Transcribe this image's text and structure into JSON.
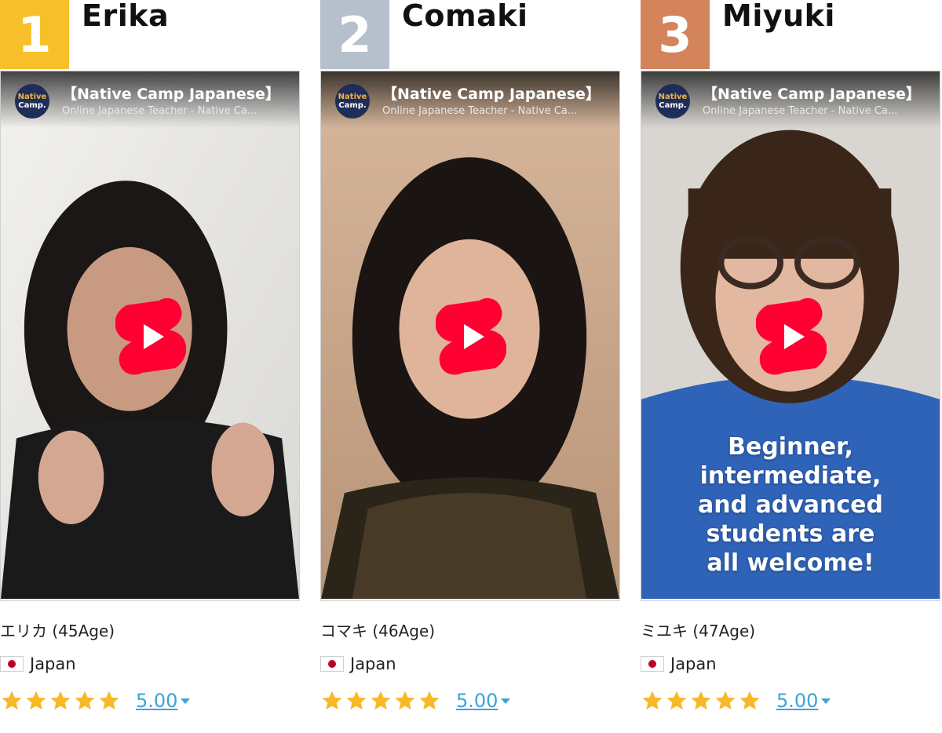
{
  "teachers": [
    {
      "rank": "1",
      "name": "Erika",
      "badge_color": "#f7c02a",
      "video": {
        "title": "【Native Camp Japanese】",
        "subtitle": "Online Japanese Teacher - Native Ca...",
        "logo_line1": "Native",
        "logo_line2": "Camp.",
        "caption": ""
      },
      "age_text": "エリカ (45Age)",
      "country": "Japan",
      "stars": 5,
      "rating": "5.00"
    },
    {
      "rank": "2",
      "name": "Comaki",
      "badge_color": "#b5c0cc",
      "video": {
        "title": "【Native Camp Japanese】",
        "subtitle": "Online Japanese Teacher - Native Ca...",
        "logo_line1": "Native",
        "logo_line2": "Camp.",
        "caption": ""
      },
      "age_text": "コマキ (46Age)",
      "country": "Japan",
      "stars": 5,
      "rating": "5.00"
    },
    {
      "rank": "3",
      "name": "Miyuki",
      "badge_color": "#d3845a",
      "video": {
        "title": "【Native Camp Japanese】",
        "subtitle": "Online Japanese Teacher - Native Ca...",
        "logo_line1": "Native",
        "logo_line2": "Camp.",
        "caption": "Beginner,\nintermediate,\nand advanced\nstudents are\nall welcome!"
      },
      "age_text": "ミユキ (47Age)",
      "country": "Japan",
      "stars": 5,
      "rating": "5.00"
    }
  ],
  "colors": {
    "star": "#f7b928",
    "rating_link": "#3ba3d8",
    "shorts_red": "#ff0033"
  },
  "icons": {
    "play": "youtube-shorts-icon",
    "star": "star-icon",
    "caret": "caret-down-icon",
    "flag": "japan-flag-icon"
  }
}
